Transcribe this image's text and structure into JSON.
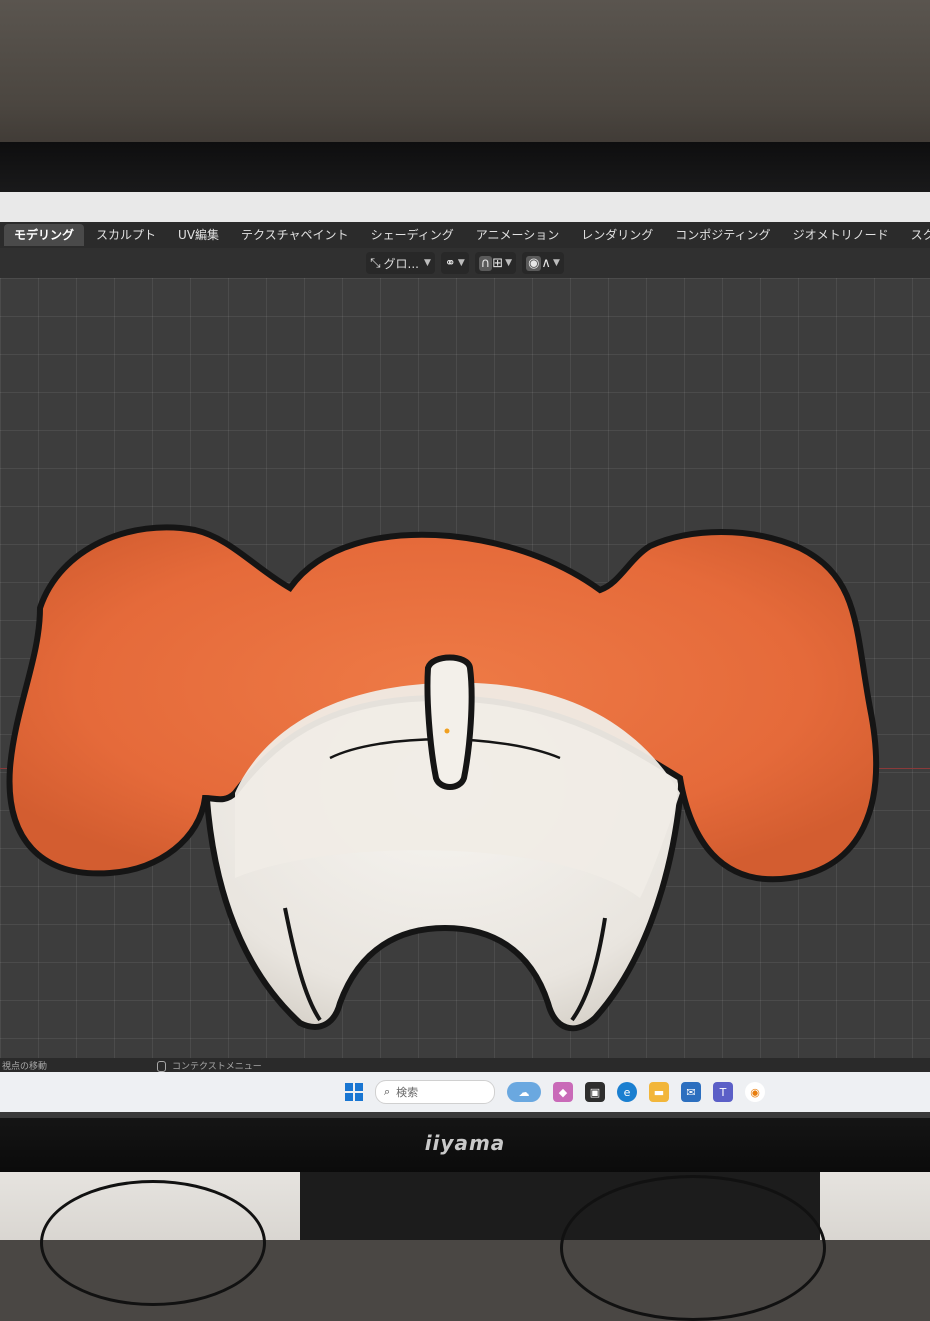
{
  "workspace_tabs": [
    {
      "label": "モデリング",
      "active": true
    },
    {
      "label": "スカルプト",
      "active": false
    },
    {
      "label": "UV編集",
      "active": false
    },
    {
      "label": "テクスチャペイント",
      "active": false
    },
    {
      "label": "シェーディング",
      "active": false
    },
    {
      "label": "アニメーション",
      "active": false
    },
    {
      "label": "レンダリング",
      "active": false
    },
    {
      "label": "コンポジティング",
      "active": false
    },
    {
      "label": "ジオメトリノード",
      "active": false
    },
    {
      "label": "スクリプト",
      "active": false
    }
  ],
  "header": {
    "transform_orientation": "グロ...",
    "icons": [
      "transform-orientation-icon",
      "pivot-point-icon",
      "snap-icon",
      "snap-target-icon",
      "proportional-edit-icon",
      "falloff-icon"
    ]
  },
  "status_bar": {
    "left": "視点の移動",
    "right": "コンテクストメニュー"
  },
  "taskbar": {
    "search_placeholder": "検索"
  },
  "monitor": {
    "brand": "iiyama"
  },
  "colors": {
    "orange_fur": "#e56a3a",
    "white_fur": "#ece8e2",
    "outline": "#151515",
    "viewport_bg": "#3d3d3d"
  }
}
